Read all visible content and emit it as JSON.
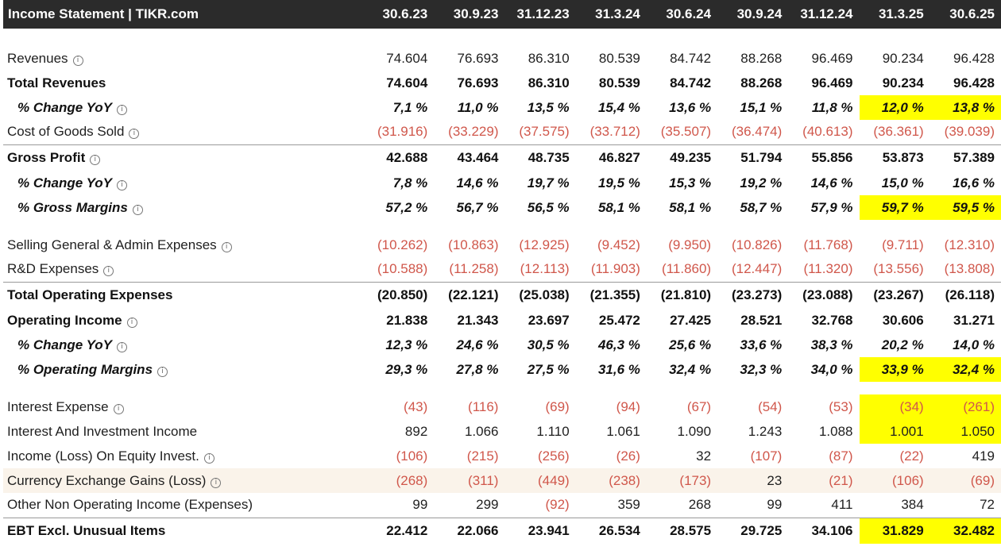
{
  "title": "Income Statement | TIKR.com",
  "info_glyph": "i",
  "periods": [
    "30.6.23",
    "30.9.23",
    "31.12.23",
    "31.3.24",
    "30.6.24",
    "30.9.24",
    "31.12.24",
    "31.3.25",
    "30.6.25"
  ],
  "rows": {
    "revenues": {
      "label": "Revenues",
      "values": [
        "74.604",
        "76.693",
        "86.310",
        "80.539",
        "84.742",
        "88.268",
        "96.469",
        "90.234",
        "96.428"
      ]
    },
    "total_revenues": {
      "label": "Total Revenues",
      "values": [
        "74.604",
        "76.693",
        "86.310",
        "80.539",
        "84.742",
        "88.268",
        "96.469",
        "90.234",
        "96.428"
      ]
    },
    "rev_yoy": {
      "label": "% Change YoY",
      "values": [
        "7,1 %",
        "11,0 %",
        "13,5 %",
        "15,4 %",
        "13,6 %",
        "15,1 %",
        "11,8 %",
        "12,0 %",
        "13,8 %"
      ]
    },
    "cogs": {
      "label": "Cost of Goods Sold",
      "values": [
        "(31.916)",
        "(33.229)",
        "(37.575)",
        "(33.712)",
        "(35.507)",
        "(36.474)",
        "(40.613)",
        "(36.361)",
        "(39.039)"
      ]
    },
    "gross_profit": {
      "label": "Gross Profit",
      "values": [
        "42.688",
        "43.464",
        "48.735",
        "46.827",
        "49.235",
        "51.794",
        "55.856",
        "53.873",
        "57.389"
      ]
    },
    "gp_yoy": {
      "label": "% Change YoY",
      "values": [
        "7,8 %",
        "14,6 %",
        "19,7 %",
        "19,5 %",
        "15,3 %",
        "19,2 %",
        "14,6 %",
        "15,0 %",
        "16,6 %"
      ]
    },
    "gross_margin": {
      "label": "% Gross Margins",
      "values": [
        "57,2 %",
        "56,7 %",
        "56,5 %",
        "58,1 %",
        "58,1 %",
        "58,7 %",
        "57,9 %",
        "59,7 %",
        "59,5 %"
      ]
    },
    "sga": {
      "label": "Selling General & Admin Expenses",
      "values": [
        "(10.262)",
        "(10.863)",
        "(12.925)",
        "(9.452)",
        "(9.950)",
        "(10.826)",
        "(11.768)",
        "(9.711)",
        "(12.310)"
      ]
    },
    "rnd": {
      "label": "R&D Expenses",
      "values": [
        "(10.588)",
        "(11.258)",
        "(12.113)",
        "(11.903)",
        "(11.860)",
        "(12.447)",
        "(11.320)",
        "(13.556)",
        "(13.808)"
      ]
    },
    "total_opex": {
      "label": "Total Operating Expenses",
      "values": [
        "(20.850)",
        "(22.121)",
        "(25.038)",
        "(21.355)",
        "(21.810)",
        "(23.273)",
        "(23.088)",
        "(23.267)",
        "(26.118)"
      ]
    },
    "op_income": {
      "label": "Operating Income",
      "values": [
        "21.838",
        "21.343",
        "23.697",
        "25.472",
        "27.425",
        "28.521",
        "32.768",
        "30.606",
        "31.271"
      ]
    },
    "oi_yoy": {
      "label": "% Change YoY",
      "values": [
        "12,3 %",
        "24,6 %",
        "30,5 %",
        "46,3 %",
        "25,6 %",
        "33,6 %",
        "38,3 %",
        "20,2 %",
        "14,0 %"
      ]
    },
    "op_margin": {
      "label": "% Operating Margins",
      "values": [
        "29,3 %",
        "27,8 %",
        "27,5 %",
        "31,6 %",
        "32,4 %",
        "32,3 %",
        "34,0 %",
        "33,9 %",
        "32,4 %"
      ]
    },
    "interest_exp": {
      "label": "Interest Expense",
      "values": [
        "(43)",
        "(116)",
        "(69)",
        "(94)",
        "(67)",
        "(54)",
        "(53)",
        "(34)",
        "(261)"
      ]
    },
    "interest_inc": {
      "label": "Interest And Investment Income",
      "values": [
        "892",
        "1.066",
        "1.110",
        "1.061",
        "1.090",
        "1.243",
        "1.088",
        "1.001",
        "1.050"
      ]
    },
    "equity_inv": {
      "label": "Income (Loss) On Equity Invest.",
      "values": [
        "(106)",
        "(215)",
        "(256)",
        "(26)",
        "32",
        "(107)",
        "(87)",
        "(22)",
        "419"
      ]
    },
    "fx": {
      "label": "Currency Exchange Gains (Loss)",
      "values": [
        "(268)",
        "(311)",
        "(449)",
        "(238)",
        "(173)",
        "23",
        "(21)",
        "(106)",
        "(69)"
      ]
    },
    "other_nonop": {
      "label": "Other Non Operating Income (Expenses)",
      "values": [
        "99",
        "299",
        "(92)",
        "359",
        "268",
        "99",
        "411",
        "384",
        "72"
      ]
    },
    "ebt": {
      "label": "EBT Excl. Unusual Items",
      "values": [
        "22.412",
        "22.066",
        "23.941",
        "26.534",
        "28.575",
        "29.725",
        "34.106",
        "31.829",
        "32.482"
      ]
    }
  },
  "colors": {
    "header_bg": "#2b2b2b",
    "negative": "#d0574b",
    "highlight": "#ffff00",
    "tint_row": "#faf3ea"
  }
}
